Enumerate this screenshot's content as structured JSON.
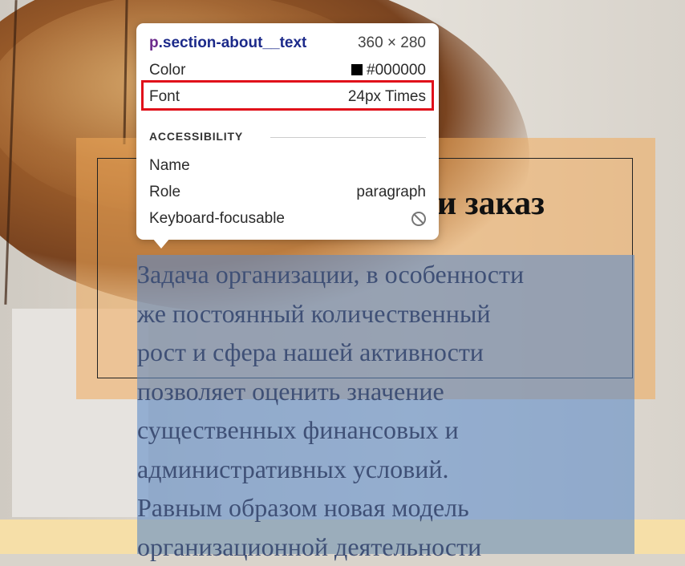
{
  "tooltip": {
    "selector_tag": "p",
    "selector_class": ".section-about__text",
    "dimensions": "360 × 280",
    "color_label": "Color",
    "color_value": "#000000",
    "color_swatch": "#000000",
    "font_label": "Font",
    "font_value": "24px Times",
    "accessibility_title": "ACCESSIBILITY",
    "name_label": "Name",
    "name_value": "",
    "role_label": "Role",
    "role_value": "paragraph",
    "keyboard_label": "Keyboard-focusable",
    "keyboard_icon": "not-allowed-icon"
  },
  "page": {
    "heading_visible": "и заказ",
    "paragraph_lines": [
      "Задача организации, в особенности",
      "же постоянный количественный",
      "рост и сфера нашей активности",
      "позволяет оценить значение",
      "существенных финансовых и",
      "административных условий.",
      "Равным образом новая модель",
      "организационной деятельности"
    ]
  },
  "colors": {
    "highlight_box": "#e0101a",
    "margin_overlay": "#f0aa5a",
    "content_overlay": "#5f8cc8"
  }
}
